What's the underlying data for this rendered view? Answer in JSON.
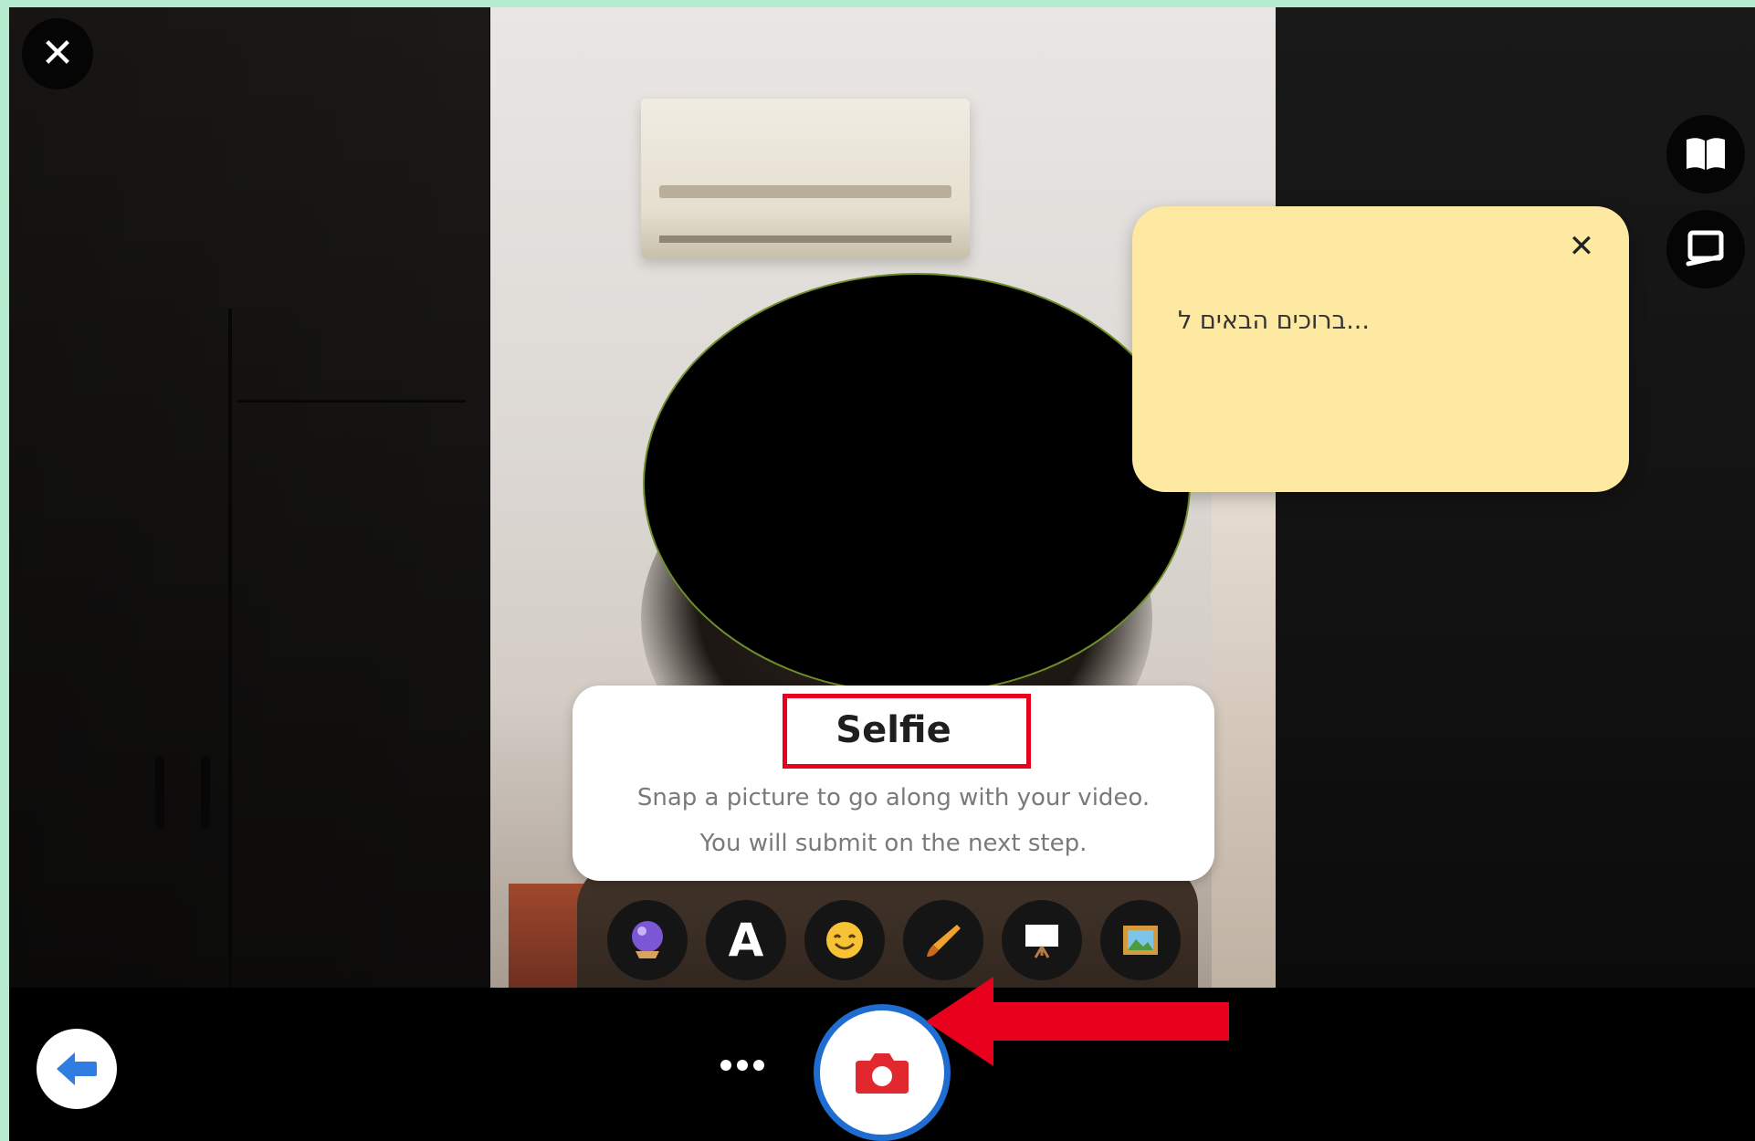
{
  "window": {
    "close_icon": "close-icon",
    "close_glyph": "✕"
  },
  "right_toolbar": {
    "items": [
      {
        "name": "book-icon"
      },
      {
        "name": "screen-share-icon"
      }
    ]
  },
  "note": {
    "close_glyph": "✕",
    "text": "...ברוכים הבאים ל"
  },
  "selfie_card": {
    "title": "Selfie",
    "description_line1": "Snap a picture to go along with your video.",
    "description_line2": "You will submit on the next step."
  },
  "tools": [
    {
      "name": "effects-tool",
      "icon": "crystal-ball-icon"
    },
    {
      "name": "text-tool",
      "icon": "text-a-icon",
      "label": "A"
    },
    {
      "name": "sticker-tool",
      "icon": "emoji-icon"
    },
    {
      "name": "draw-tool",
      "icon": "paintbrush-icon"
    },
    {
      "name": "board-tool",
      "icon": "whiteboard-icon"
    },
    {
      "name": "frame-tool",
      "icon": "picture-frame-icon"
    }
  ],
  "bottom_bar": {
    "back_icon": "back-arrow-icon",
    "more_icon": "more-dots-icon",
    "capture_icon": "camera-icon"
  },
  "colors": {
    "outer_border": "#b5ecd0",
    "note_bg": "#fde9a2",
    "highlight": "#e8001d",
    "capture_ring": "#1f6dd1",
    "capture_icon": "#e0282e",
    "back_arrow": "#2f7de0"
  }
}
